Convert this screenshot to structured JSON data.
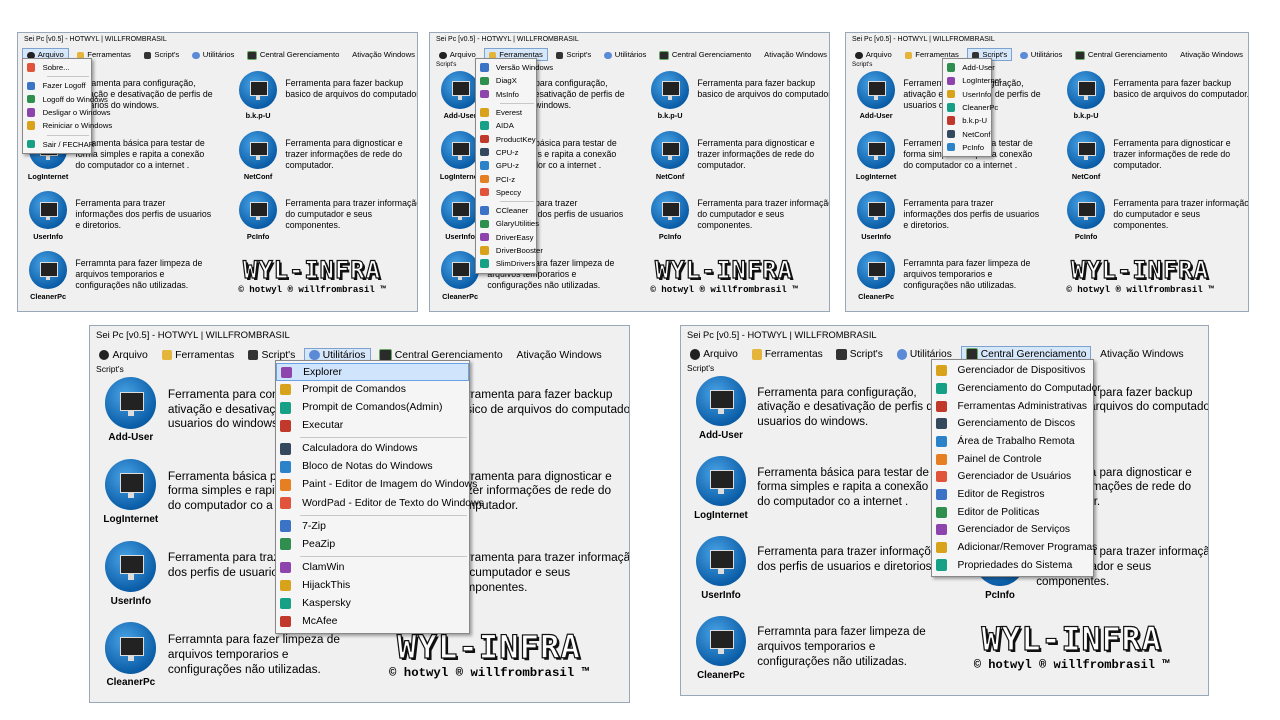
{
  "app": {
    "title": "Sei Pc [v0.5] - HOTWYL | WILLFROMBRASIL",
    "scripts_label": "Script's",
    "menu": [
      "Arquivo",
      "Ferramentas",
      "Script's",
      "Utilitários",
      "Central Gerenciamento",
      "Ativação Windows"
    ],
    "tools": [
      {
        "label": "Add-User",
        "desc": "Ferramenta para configuração, ativação e desativação de perfis de usuarios do windows."
      },
      {
        "label": "b.k.p-U",
        "desc": "Ferramenta para fazer backup basico de arquivos do computador."
      },
      {
        "label": "LogInternet",
        "desc": "Ferramenta básica para testar de forma simples e rapita a conexão do computador co a internet ."
      },
      {
        "label": "NetConf",
        "desc": "Ferramenta para dignosticar e trazer informações de rede do computador."
      },
      {
        "label": "UserInfo",
        "desc": "Ferramenta para trazer informações dos perfis de usuarios e diretorios."
      },
      {
        "label": "PcInfo",
        "desc": "Ferramenta para trazer informação do cumputador e seus componentes."
      },
      {
        "label": "CleanerPc",
        "desc": "Ferramnta para fazer limpeza de arquivos temporarios e configurações não utilizadas."
      }
    ],
    "brand": {
      "logo": "WYL-INFRA",
      "tagline": "© hotwyl ® willfrombrasil ™"
    }
  },
  "menus": {
    "arquivo": [
      "Sobre...",
      "Fazer Logoff",
      "Logoff do Windows",
      "Desligar o Windows",
      "Reiniciar o Windows",
      "Sair / FECHAR"
    ],
    "ferramentas": [
      "Versão Windows",
      "DiagX",
      "MsInfo",
      "Everest",
      "AIDA",
      "ProductKey",
      "CPU-z",
      "GPU-z",
      "PCI-z",
      "Speccy",
      "CCleaner",
      "GlaryUtilities",
      "DriverEasy",
      "DriverBooster",
      "SlimDrivers"
    ],
    "scripts": [
      "Add-User",
      "LogInternet",
      "UserInfo",
      "CleanerPc",
      "b.k.p-U",
      "NetConf",
      "PcInfo"
    ],
    "utilitarios": [
      "Explorer",
      "Prompit de Comandos",
      "Prompit de Comandos(Admin)",
      "Executar",
      "Calculadora do Windows",
      "Bloco de Notas do Windows",
      "Paint - Editor de Imagem do Windows",
      "WordPad - Editor de Texto do Windows",
      "7-Zip",
      "PeaZip",
      "ClamWin",
      "HijackThis",
      "Kaspersky",
      "McAfee"
    ],
    "central": [
      "Gerenciador de Dispositivos",
      "Gerenciamento do Computador",
      "Ferramentas Administrativas",
      "Gerenciamento de Discos",
      "Área de Trabalho Remota",
      "Painel de Controle",
      "Gerenciador de Usuários",
      "Editor de Registros",
      "Editor de Politicas",
      "Gerenciador de Serviços",
      "Adicionar/Remover Programas",
      "Propriedades do Sistema"
    ]
  },
  "colors": {
    "accent": "#0b5ea8",
    "highlight": "#d0e4fb",
    "window_bg": "#f0f0f0"
  }
}
